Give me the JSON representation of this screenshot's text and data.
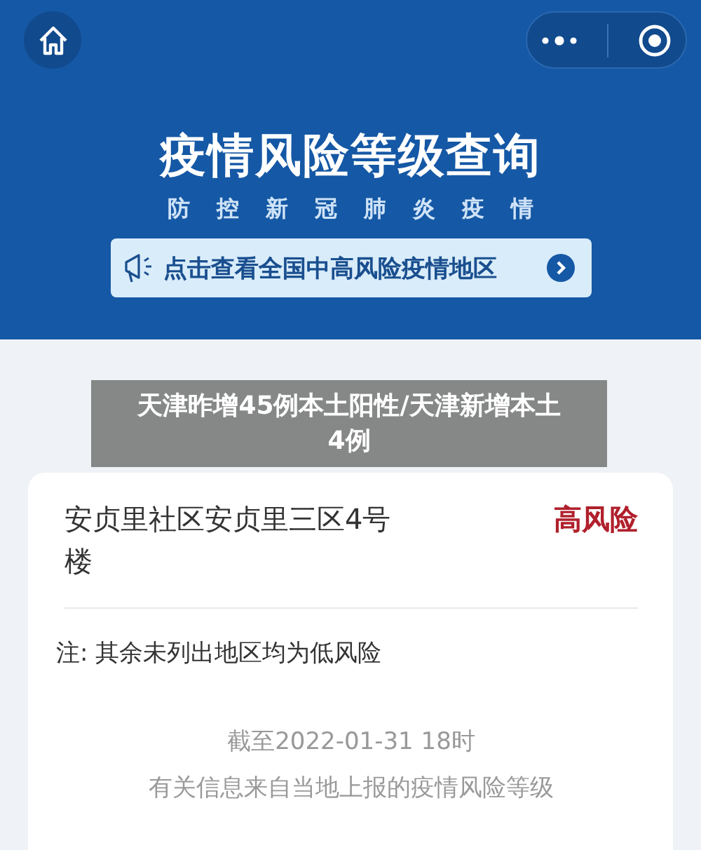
{
  "header": {
    "title": "疫情风险等级查询",
    "subtitle": "防控新冠肺炎疫情",
    "banner": "点击查看全国中高风险疫情地区"
  },
  "caption": "天津昨增45例本土阳性/天津新增本土4例",
  "areas": [
    {
      "name": "安贞里社区安贞里三区4号楼",
      "risk": "高风险",
      "color": "#b0202c"
    }
  ],
  "note": "注: 其余未列出地区均为低风险",
  "footer": [
    "截至2022-01-31 18时",
    "有关信息来自当地上报的疫情风险等级"
  ]
}
